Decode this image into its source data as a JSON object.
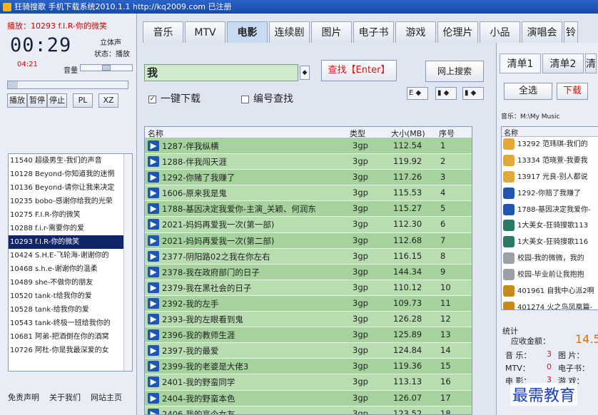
{
  "window": {
    "title": "狂骑搜歌 手机下载系统2010.1.1 http://kq2009.com 已注册"
  },
  "player": {
    "now_playing": "播放：10293 f.I.R-你的微笑",
    "time": "00:29",
    "mode": "立体声",
    "status": "状态：播放",
    "small_time": "04:21",
    "volume_label": "音量",
    "controls": [
      "播放",
      "暂停",
      "停止"
    ],
    "extra": [
      "PL",
      "XZ"
    ]
  },
  "playlist": {
    "items": [
      "11540 超级男生-我们的声音",
      "10128 Beyond-你知道我的迷惘",
      "10136 Beyond-请你让我来决定",
      "10235 bobo-感谢你给我的光荣",
      "10275 F.I.R-你的微笑",
      "10288 f.i.r-需要你的爱",
      "10293 f.I.R-你的微笑",
      "10424 S.H.E-飞轮海-谢谢你的",
      "10468 s.h.e-谢谢你的温柔",
      "10489 she-不做你的朋友",
      "10520 tank-t给我你的爱",
      "10528 tank-给我你的爱",
      "10543 tank-终极一班给我你的",
      "10681 阿弟-把酒倒在你的酒窝",
      "10726 阿杜-你是我最深爱的女"
    ],
    "selected_index": 6
  },
  "footer": {
    "links": [
      "免责声明",
      "关于我们",
      "网站主页"
    ]
  },
  "tabs": [
    "音乐",
    "MTV",
    "电影",
    "连续剧",
    "图片",
    "电子书",
    "游戏",
    "伦理片",
    "小品",
    "演唱会",
    "铃"
  ],
  "active_tab": 2,
  "search": {
    "value": "我",
    "find_label": "查找【Enter】",
    "net_label": "网上搜索",
    "one_click": "一键下载",
    "number_find": "编号查找",
    "mini_e": "E"
  },
  "table": {
    "columns": [
      "名称",
      "类型",
      "大小(MB)",
      "序号"
    ],
    "rows": [
      {
        "name": "1287-伴我纵横",
        "type": "3gp",
        "size": "112.54",
        "no": "1"
      },
      {
        "name": "1288-伴我闯天涯",
        "type": "3gp",
        "size": "119.92",
        "no": "2"
      },
      {
        "name": "1292-你赌了我赚了",
        "type": "3gp",
        "size": "117.26",
        "no": "3"
      },
      {
        "name": "1606-原来我是鬼",
        "type": "3gp",
        "size": "115.53",
        "no": "4"
      },
      {
        "name": "1788-基因决定我爱你-主演_关颖、何润东",
        "type": "3gp",
        "size": "115.27",
        "no": "5"
      },
      {
        "name": "2021-妈妈再爱我一次(第一部)",
        "type": "3gp",
        "size": "112.30",
        "no": "6"
      },
      {
        "name": "2021-妈妈再爱我一次(第二部)",
        "type": "3gp",
        "size": "112.68",
        "no": "7"
      },
      {
        "name": "2377-阴阳路02之我在你左右",
        "type": "3gp",
        "size": "116.15",
        "no": "8"
      },
      {
        "name": "2378-我在政府部门的日子",
        "type": "3gp",
        "size": "144.34",
        "no": "9"
      },
      {
        "name": "2379-我在黑社会的日子",
        "type": "3gp",
        "size": "110.12",
        "no": "10"
      },
      {
        "name": "2392-我的左手",
        "type": "3gp",
        "size": "109.73",
        "no": "11"
      },
      {
        "name": "2393-我的左眼看到鬼",
        "type": "3gp",
        "size": "126.28",
        "no": "12"
      },
      {
        "name": "2396-我的教师生涯",
        "type": "3gp",
        "size": "125.89",
        "no": "13"
      },
      {
        "name": "2397-我的最爱",
        "type": "3gp",
        "size": "124.84",
        "no": "14"
      },
      {
        "name": "2399-我的老婆是大佬3",
        "type": "3gp",
        "size": "119.36",
        "no": "15"
      },
      {
        "name": "2401-我的野蛮同学",
        "type": "3gp",
        "size": "113.13",
        "no": "16"
      },
      {
        "name": "2404-我的野蛮本色",
        "type": "3gp",
        "size": "126.07",
        "no": "17"
      },
      {
        "name": "2406-我的高个女友",
        "type": "3gp",
        "size": "123.52",
        "no": "18"
      }
    ]
  },
  "right": {
    "tabs": [
      "清单1",
      "清单2",
      "清"
    ],
    "select_all": "全选",
    "download": "下载",
    "music_path": "音乐：M:\\My Music",
    "list_header": "名称",
    "items": [
      {
        "text": "13292 范玮琪-我们的",
        "icon": "face"
      },
      {
        "text": "13334 范晓萱-我要我",
        "icon": "face"
      },
      {
        "text": "13917 光良-别人都说",
        "icon": "face"
      },
      {
        "text": "1292-你赔了我赚了",
        "icon": "video"
      },
      {
        "text": "1788-基因决定我爱你-",
        "icon": "video"
      },
      {
        "text": "1大美女-狂骑搜歌113",
        "icon": "image"
      },
      {
        "text": "1大美女-狂骑搜歌116",
        "icon": "image"
      },
      {
        "text": "校园-我的微微，我的",
        "icon": "doc"
      },
      {
        "text": "校园-毕业前让我抱抱",
        "icon": "doc"
      },
      {
        "text": "401961 自我中心派2啊",
        "icon": "game"
      },
      {
        "text": "401274 火之鸟凤凰篇-",
        "icon": "game"
      }
    ],
    "stats": {
      "title": "统计",
      "amount_label": "应收金额：",
      "amount": "14.5",
      "music_label": "音  乐：",
      "music": "3",
      "image_label": "图 片：",
      "mtv_label": "MTV：",
      "mtv": "0",
      "ebook_label": "电子书：",
      "movie_label": "电  影：",
      "movie": "3",
      "game_label": "游 戏："
    }
  },
  "watermark": "最需教育"
}
